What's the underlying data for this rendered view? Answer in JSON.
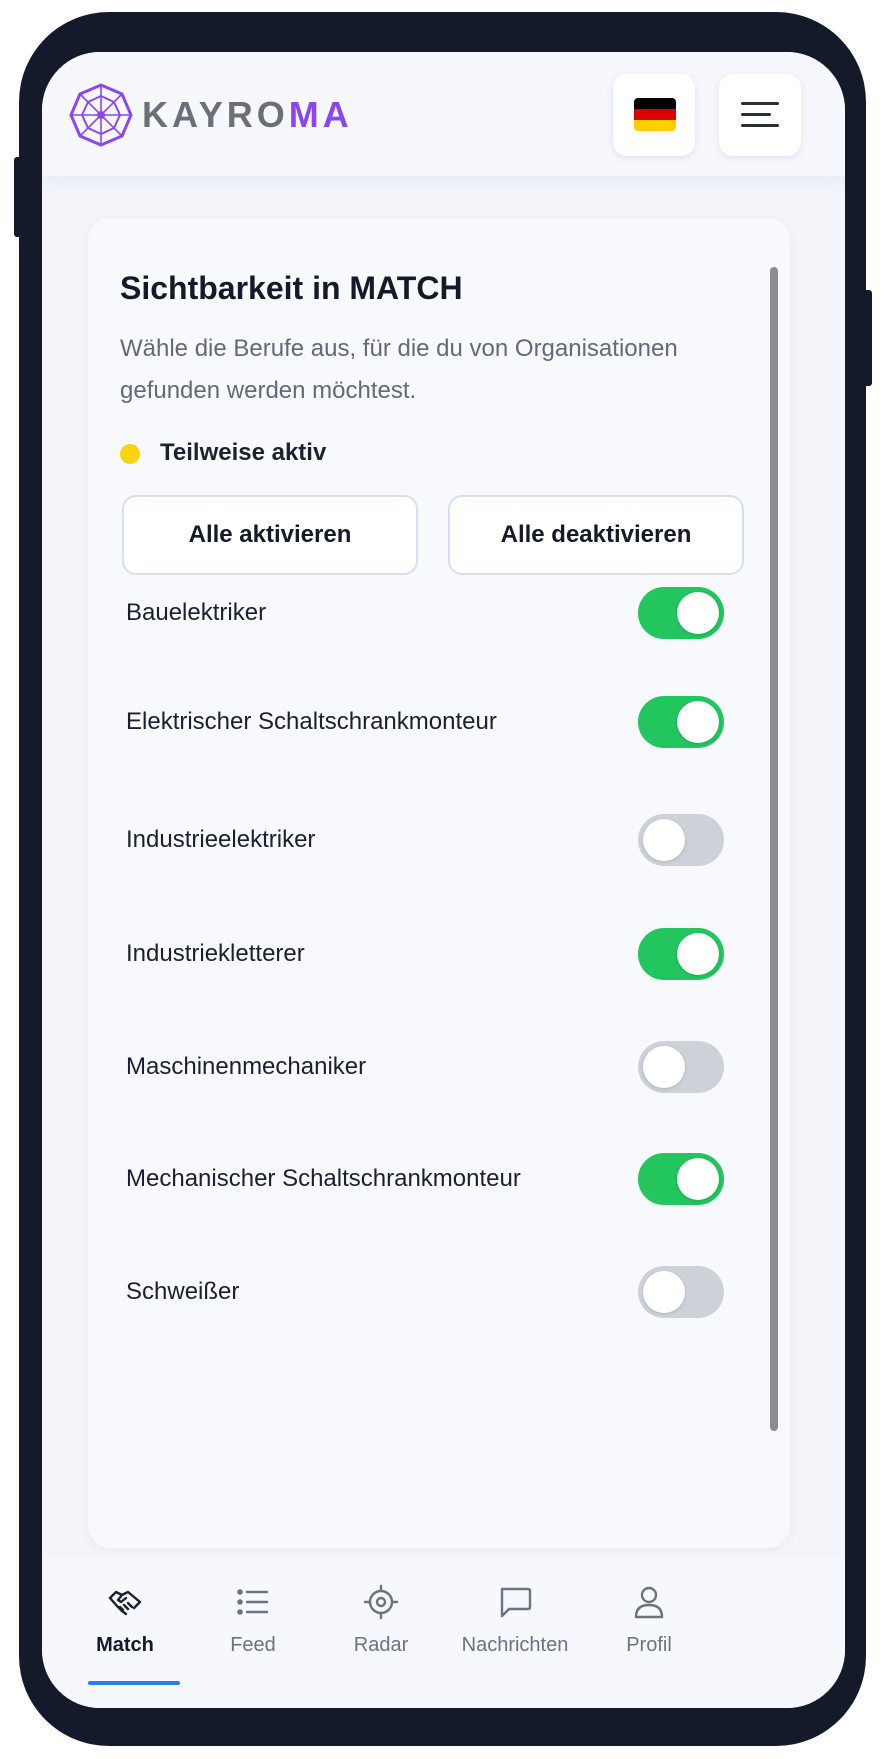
{
  "header": {
    "brand_prefix": "KAYRO",
    "brand_suffix": "MA",
    "flag_colors": [
      "#000000",
      "#dd0000",
      "#ffce00"
    ],
    "brand_accent": "#8b46f2"
  },
  "card": {
    "title": "Sichtbarkeit in MATCH",
    "description": "Wähle die Berufe aus, für die du von Organisationen gefunden werden möchtest.",
    "status": {
      "label": "Teilweise aktiv",
      "color": "#fad40f"
    },
    "buttons": {
      "activate_all": "Alle aktivieren",
      "deactivate_all": "Alle deaktivieren"
    },
    "jobs": [
      {
        "label": "Bauelektriker",
        "enabled": true
      },
      {
        "label": "Elektrischer Schaltschrankmonteur",
        "enabled": true
      },
      {
        "label": "Industrieelektriker",
        "enabled": false
      },
      {
        "label": "Industriekletterer",
        "enabled": true
      },
      {
        "label": "Maschinenmechaniker",
        "enabled": false
      },
      {
        "label": "Mechanischer Schaltschrankmonteur",
        "enabled": true
      },
      {
        "label": "Schweißer",
        "enabled": false
      }
    ]
  },
  "nav": {
    "items": [
      {
        "label": "Match",
        "icon": "handshake-icon",
        "active": true
      },
      {
        "label": "Feed",
        "icon": "list-icon",
        "active": false
      },
      {
        "label": "Radar",
        "icon": "crosshair-icon",
        "active": false
      },
      {
        "label": "Nachrichten",
        "icon": "chat-bubble-icon",
        "active": false
      },
      {
        "label": "Profil",
        "icon": "user-icon",
        "active": false
      }
    ]
  },
  "colors": {
    "toggle_on": "#22c55e",
    "toggle_off": "#cdd1d8",
    "nav_active_indicator": "#2d7de8"
  }
}
